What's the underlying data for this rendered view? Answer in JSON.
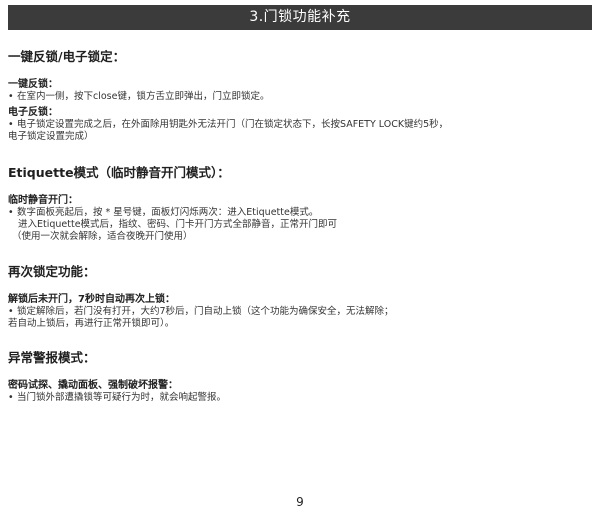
{
  "header": {
    "title": "3.门锁功能补充"
  },
  "sections": [
    {
      "title": "一键反锁/电子锁定：",
      "blocks": [
        {
          "subtitle": "一键反锁：",
          "lines": [
            "在室内一侧，按下close键，锁方舌立即弹出，门立即锁定。"
          ]
        },
        {
          "subtitle": "电子反锁：",
          "lines": [
            "电子锁定设置完成之后，在外面除用钥匙外无法开门（门在锁定状态下，长按SAFETY LOCK键约5秒，",
            "电子锁定设置完成）"
          ]
        }
      ]
    },
    {
      "title": "Etiquette模式（临时静音开门模式）：",
      "blocks": [
        {
          "subtitle": "临时静音开门：",
          "lines": [
            "数字面板亮起后，按 * 星号键，面板灯闪烁两次：进入Etiquette模式。",
            "进入Etiquette模式后，指纹、密码、门卡开门方式全部静音，正常开门即可",
            "（使用一次就会解除，适合夜晚开门使用）"
          ]
        }
      ]
    },
    {
      "title": "再次锁定功能：",
      "blocks": [
        {
          "subtitle": "解锁后未开门，7秒时自动再次上锁：",
          "lines": [
            "锁定解除后，若门没有打开，大约7秒后，门自动上锁（这个功能为确保安全，无法解除；",
            "若自动上锁后，再进行正常开锁即可）。"
          ]
        }
      ]
    },
    {
      "title": "异常警报模式：",
      "blocks": [
        {
          "subtitle": "密码试探、撬动面板、强制破坏报警：",
          "lines": [
            "当门锁外部遭撬锁等可疑行为时，就会响起警报。"
          ]
        }
      ]
    }
  ],
  "footer": {
    "page_number": "9"
  }
}
